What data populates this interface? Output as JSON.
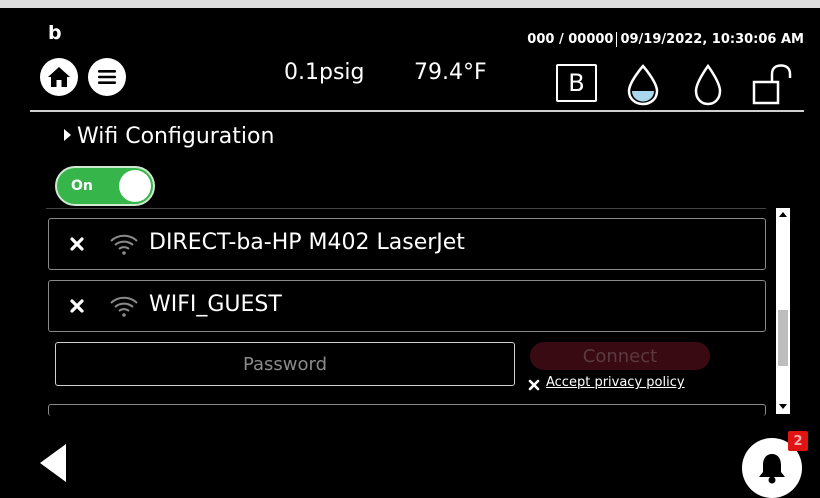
{
  "header": {
    "brand": "b",
    "counter": "000 / 00000",
    "datetime": "09/19/2022, 10:30:06 AM",
    "pressure": "0.1psig",
    "temperature": "79.4°F",
    "mode_label": "B",
    "icons": [
      "home-icon",
      "menu-icon",
      "water-drop-filled-icon",
      "water-drop-outline-icon",
      "unlocked-padlock-icon"
    ]
  },
  "wifi": {
    "section_title": "Wifi Configuration",
    "toggle_label": "On",
    "toggle_state": "on",
    "networks": [
      {
        "name": "DIRECT-ba-HP M402 LaserJet",
        "icon": "wifi-signal-icon"
      },
      {
        "name": "WIFI_GUEST",
        "icon": "wifi-signal-icon"
      }
    ],
    "password_placeholder": "Password",
    "password_value": "",
    "connect_label": "Connect",
    "accept_label": "Accept privacy policy"
  },
  "footer": {
    "notification_count": "2"
  },
  "colors": {
    "background": "#000000",
    "toggle_on": "#35b54a",
    "connect_disabled": "#3a0a12",
    "badge": "#e11414"
  }
}
